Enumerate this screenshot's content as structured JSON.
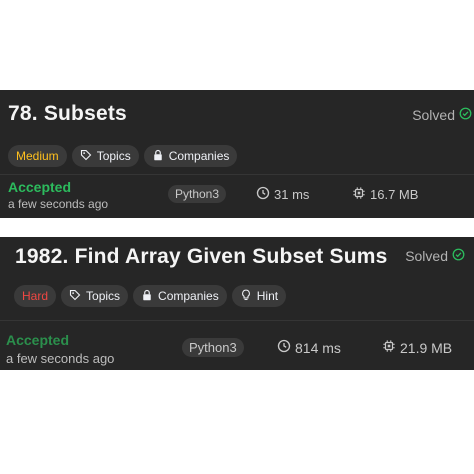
{
  "submissions": [
    {
      "title": "78. Subsets",
      "solved_label": "Solved",
      "difficulty": "Medium",
      "tags": {
        "topics": "Topics",
        "companies": "Companies"
      },
      "status": "Accepted",
      "time_ago": "a few seconds ago",
      "language": "Python3",
      "runtime": "31 ms",
      "memory": "16.7 MB"
    },
    {
      "title": "1982. Find Array Given Subset Sums",
      "solved_label": "Solved",
      "difficulty": "Hard",
      "tags": {
        "topics": "Topics",
        "companies": "Companies",
        "hint": "Hint"
      },
      "status": "Accepted",
      "time_ago": "a few seconds ago",
      "language": "Python3",
      "runtime": "814 ms",
      "memory": "21.9 MB"
    }
  ],
  "colors": {
    "card_bg": "#262626",
    "accepted_green": "#2cbb5d",
    "medium_yellow": "#ffc01e",
    "hard_red": "#ef4743",
    "solved_check_green": "#2cbb5d"
  },
  "icons": [
    "check-circle-icon",
    "tag-icon",
    "lock-icon",
    "lightbulb-icon",
    "clock-icon",
    "chip-icon"
  ]
}
